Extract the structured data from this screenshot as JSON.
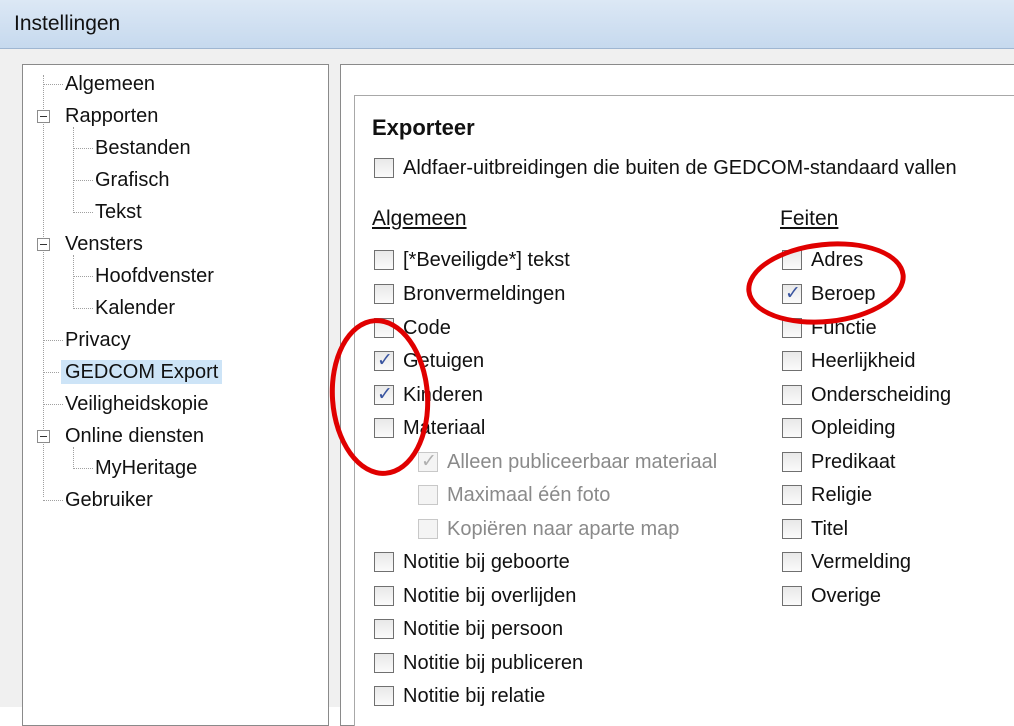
{
  "window": {
    "title": "Instellingen"
  },
  "tree": {
    "items": [
      {
        "label": "Algemeen"
      },
      {
        "label": "Rapporten"
      },
      {
        "label": "Bestanden"
      },
      {
        "label": "Grafisch"
      },
      {
        "label": "Tekst"
      },
      {
        "label": "Vensters"
      },
      {
        "label": "Hoofdvenster"
      },
      {
        "label": "Kalender"
      },
      {
        "label": "Privacy"
      },
      {
        "label": "GEDCOM Export",
        "selected": true
      },
      {
        "label": "Veiligheidskopie"
      },
      {
        "label": "Online diensten"
      },
      {
        "label": "MyHeritage"
      },
      {
        "label": "Gebruiker"
      }
    ]
  },
  "panel": {
    "heading": "Exporteer",
    "extensions": {
      "label": "Aldfaer-uitbreidingen die buiten de GEDCOM-standaard vallen",
      "checked": false
    },
    "general": {
      "title": "Algemeen",
      "items": [
        {
          "label": "[*Beveiligde*] tekst",
          "checked": false
        },
        {
          "label": "Bronvermeldingen",
          "checked": false
        },
        {
          "label": "Code",
          "checked": false
        },
        {
          "label": "Getuigen",
          "checked": true
        },
        {
          "label": "Kinderen",
          "checked": true
        },
        {
          "label": "Materiaal",
          "checked": false
        },
        {
          "label": "Alleen publiceerbaar materiaal",
          "checked": true,
          "disabled": true
        },
        {
          "label": "Maximaal één foto",
          "checked": false,
          "disabled": true
        },
        {
          "label": "Kopiëren naar aparte map",
          "checked": false,
          "disabled": true
        },
        {
          "label": "Notitie bij geboorte",
          "checked": false
        },
        {
          "label": "Notitie bij overlijden",
          "checked": false
        },
        {
          "label": "Notitie bij persoon",
          "checked": false
        },
        {
          "label": "Notitie bij publiceren",
          "checked": false
        },
        {
          "label": "Notitie bij relatie",
          "checked": false
        }
      ]
    },
    "facts": {
      "title": "Feiten",
      "items": [
        {
          "label": "Adres",
          "checked": false
        },
        {
          "label": "Beroep",
          "checked": true
        },
        {
          "label": "Functie",
          "checked": false
        },
        {
          "label": "Heerlijkheid",
          "checked": false
        },
        {
          "label": "Onderscheiding",
          "checked": false
        },
        {
          "label": "Opleiding",
          "checked": false
        },
        {
          "label": "Predikaat",
          "checked": false
        },
        {
          "label": "Religie",
          "checked": false
        },
        {
          "label": "Titel",
          "checked": false
        },
        {
          "label": "Vermelding",
          "checked": false
        },
        {
          "label": "Overige",
          "checked": false
        }
      ]
    }
  },
  "annotation_color": "#e00000"
}
